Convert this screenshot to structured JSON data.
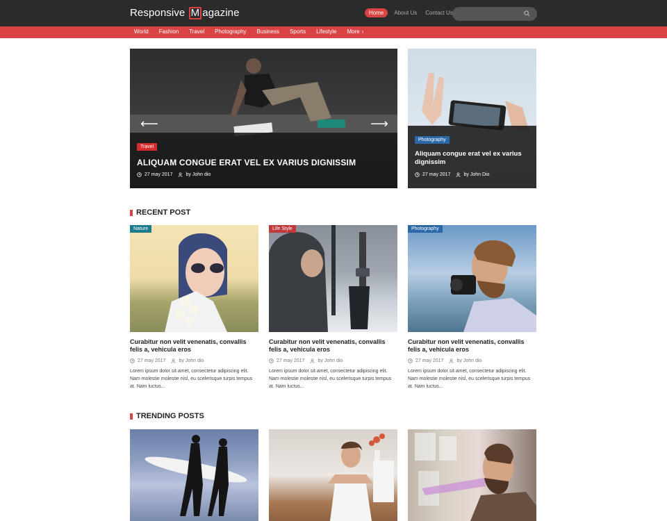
{
  "header": {
    "logo_before": "Responsive ",
    "logo_m": "M",
    "logo_after": "agazine",
    "nav": [
      {
        "label": "Home",
        "active": true
      },
      {
        "label": "About Us",
        "active": false
      },
      {
        "label": "Contact Us",
        "active": false
      }
    ],
    "search_placeholder": ""
  },
  "categories": [
    "World",
    "Fashion",
    "Travel",
    "Photography",
    "Business",
    "Sports",
    "Lifestyle",
    "More"
  ],
  "hero": {
    "main": {
      "tag": "Travel",
      "title": "ALIQUAM CONGUE ERAT VEL EX VARIUS DIGNISSIM",
      "date": "27 may 2017",
      "author": "by John dio"
    },
    "side": {
      "tag": "Photography",
      "title": "Aliquam congue erat vel ex varius dignissim",
      "date": "27 may 2017",
      "author": "by John Dio"
    }
  },
  "recent": {
    "heading": "RECENT POST",
    "posts": [
      {
        "tag": "Nature",
        "title": "Curabitur non velit venenatis, convallis felis a, vehicula eros",
        "date": "27 may 2017",
        "author": "by John dio",
        "excerpt": "Lorem ipsum dolor sit amet, consectetur adipiscing elit. Nam molestie molestie nisl, eu scelerisque turpis tempus at. Nam luctus..."
      },
      {
        "tag": "Life Style",
        "title": "Curabitur non velit venenatis, convallis felis a, vehicula eros",
        "date": "27 may 2017",
        "author": "by John dio",
        "excerpt": "Lorem ipsum dolor sit amet, consectetur adipiscing elit. Nam molestie molestie nisl, eu scelerisque turpis tempus at. Nam luctus..."
      },
      {
        "tag": "Photography",
        "title": "Curabitur non velit venenatis, convallis felis a, vehicula eros",
        "date": "27 may 2017",
        "author": "by John dio",
        "excerpt": "Lorem ipsum dolor sit amet, consectetur adipiscing elit. Nam molestie molestie nisl, eu scelerisque turpis tempus at. Nam luctus..."
      }
    ]
  },
  "trending": {
    "heading": "TRENDING POSTS"
  },
  "colors": {
    "accent": "#d94343",
    "header_bg": "#2b2b2b",
    "tag_blue": "#2c68a8",
    "tag_teal": "#1e7b8b"
  },
  "icons": [
    "search-icon",
    "clock-icon",
    "user-icon",
    "chevron-right-icon",
    "arrow-left-icon",
    "arrow-right-icon"
  ]
}
